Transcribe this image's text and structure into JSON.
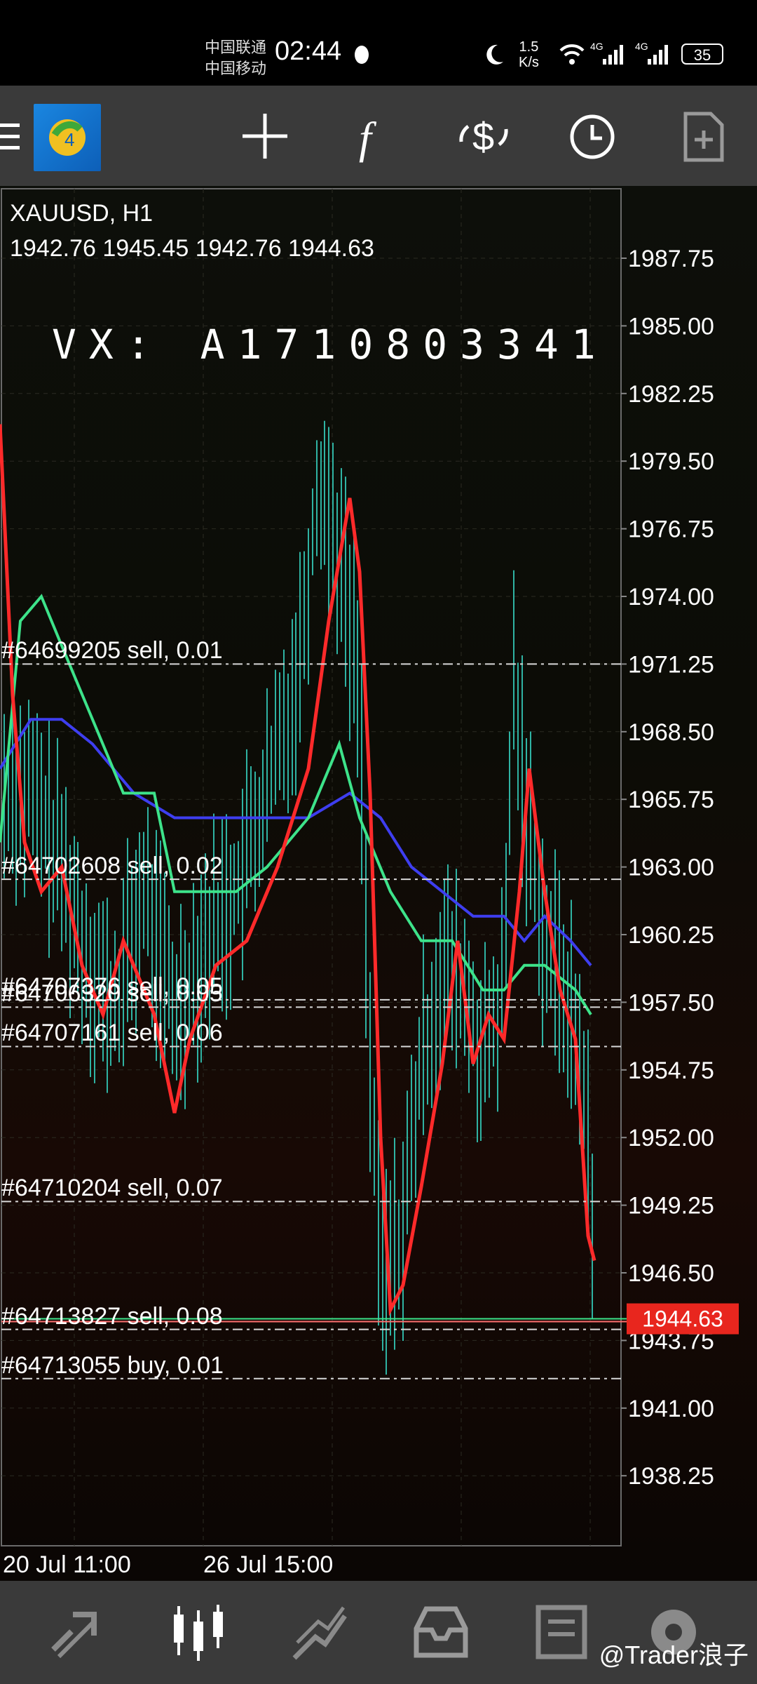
{
  "status_bar": {
    "carrier_1": "中国联通",
    "carrier_2": "中国移动",
    "time": "02:44",
    "net_speed_value": "1.5",
    "net_speed_unit": "K/s",
    "signal_1": "4G",
    "signal_2": "4G",
    "battery": "35"
  },
  "toolbar": {
    "icons": [
      "menu-icon",
      "metatrader-logo-icon",
      "crosshair-icon",
      "function-icon",
      "symbol-swap-icon",
      "timeframe-clock-icon",
      "template-add-icon"
    ]
  },
  "chart": {
    "symbol_label": "XAUUSD, H1",
    "ohlc": "1942.76 1945.45 1942.76 1944.63",
    "watermark": "VX: A1710803341",
    "price_axis": [
      "1987.75",
      "1985.00",
      "1982.25",
      "1979.50",
      "1976.75",
      "1974.00",
      "1971.25",
      "1968.50",
      "1965.75",
      "1963.00",
      "1960.25",
      "1957.50",
      "1954.75",
      "1952.00",
      "1949.25",
      "1946.50",
      "1943.75",
      "1941.00",
      "1938.25"
    ],
    "current_price": "1944.63",
    "time_axis": [
      "20 Jul 11:00",
      "26 Jul 15:00"
    ],
    "orders": [
      {
        "label": "#64699205 sell, 0.01",
        "price": 1971.25
      },
      {
        "label": "#64702608 sell, 0.02",
        "price": 1962.5
      },
      {
        "label": "#64707376 sell, 0.05",
        "price": 1957.6
      },
      {
        "label": "#64706320 sell, 0.05",
        "price": 1957.3
      },
      {
        "label": "#64707161 sell, 0.06",
        "price": 1955.7
      },
      {
        "label": "#64710204 sell, 0.07",
        "price": 1949.4
      },
      {
        "label": "#64713827 sell, 0.08",
        "price": 1944.2
      },
      {
        "label": "#64713055 buy, 0.01",
        "price": 1942.2
      }
    ],
    "colors": {
      "candle": "#2fb3a3",
      "ma_fast": "#ff2a2a",
      "ma_mid": "#3de38a",
      "ma_slow": "#3e3ef0",
      "price_tag": "#e8261e",
      "order_line": "#d8d8d8"
    }
  },
  "bottom_nav": {
    "items": [
      "quotes-icon",
      "chart-icon",
      "trade-icon",
      "history-icon",
      "messages-icon",
      "settings-icon"
    ]
  },
  "watermark_footer": "@Trader浪子"
}
